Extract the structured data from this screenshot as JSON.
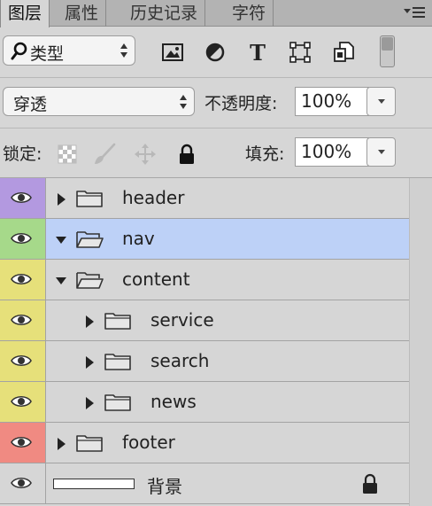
{
  "tabs": [
    {
      "label": "图层",
      "active": true
    },
    {
      "label": "属性",
      "active": false
    },
    {
      "label": "历史记录",
      "active": false
    },
    {
      "label": "字符",
      "active": false
    }
  ],
  "filter": {
    "kind_label": "类型",
    "icons": [
      "image-filter-icon",
      "adjustment-filter-icon",
      "type-filter-icon",
      "shape-filter-icon",
      "smart-object-filter-icon"
    ]
  },
  "blend": {
    "mode": "穿透",
    "opacity_label": "不透明度:",
    "opacity_value": "100%"
  },
  "lock": {
    "label": "锁定:",
    "fill_label": "填充:",
    "fill_value": "100%"
  },
  "layers": [
    {
      "name": "header",
      "eye_color": "#b399e0",
      "expanded": false,
      "indent": 0,
      "selected": false
    },
    {
      "name": "nav",
      "eye_color": "#a6d98a",
      "expanded": true,
      "indent": 0,
      "selected": true
    },
    {
      "name": "content",
      "eye_color": "#e6e07a",
      "expanded": true,
      "indent": 0,
      "selected": false
    },
    {
      "name": "service",
      "eye_color": "#e6e07a",
      "expanded": false,
      "indent": 1,
      "selected": false
    },
    {
      "name": "search",
      "eye_color": "#e6e07a",
      "expanded": false,
      "indent": 1,
      "selected": false
    },
    {
      "name": "news",
      "eye_color": "#e6e07a",
      "expanded": false,
      "indent": 1,
      "selected": false
    },
    {
      "name": "footer",
      "eye_color": "#f08a82",
      "expanded": false,
      "indent": 0,
      "selected": false
    },
    {
      "name": "背景",
      "eye_color": "#d6d6d6",
      "background": true,
      "locked": true
    }
  ]
}
